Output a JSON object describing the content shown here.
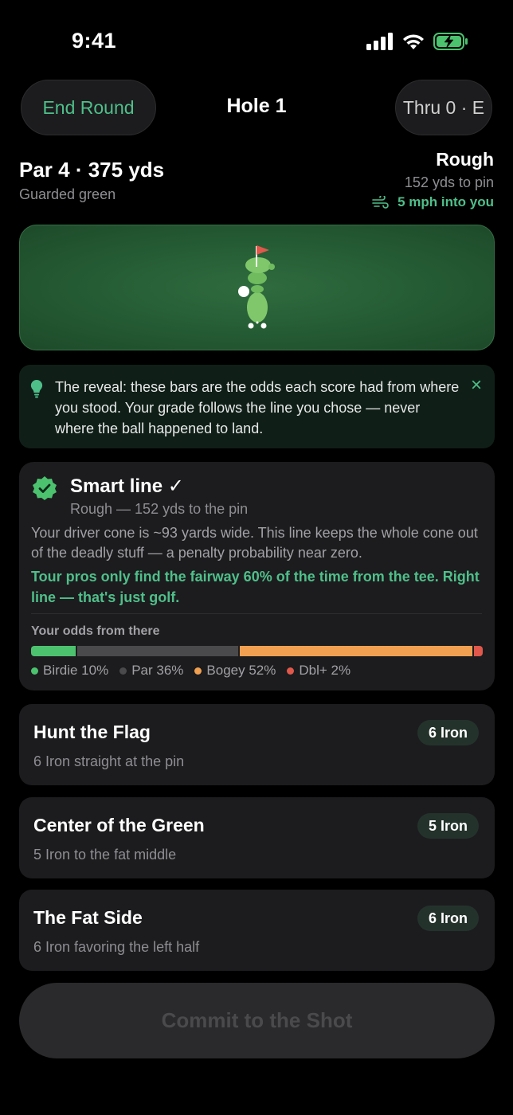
{
  "status": {
    "time": "9:41"
  },
  "header": {
    "end_round_label": "End Round",
    "title": "Hole 1",
    "progress_label": "Thru 0 · E"
  },
  "hole": {
    "par_yards": "Par 4 · 375 yds",
    "feature": "Guarded green",
    "lie": "Rough",
    "to_pin": "152 yds to pin",
    "wind": "5 mph into you"
  },
  "tip": {
    "text": "The reveal: these bars are the odds each score had from where you stood. Your grade follows the line you chose — never where the ball happened to land.",
    "close_icon": "×"
  },
  "smart_card": {
    "title": "Smart line ✓",
    "subtitle": "Rough — 152 yds to the pin",
    "body": "Your driver cone is ~93 yards wide. This line keeps the whole cone out of the deadly stuff — a penalty probability near zero.",
    "tour_note": "Tour pros only find the fairway 60% of the time from the tee. Right line — that's just golf.",
    "odds_title": "Your odds from there",
    "odds": [
      {
        "label": "Birdie 10%",
        "value": 10,
        "color": "#4cc26f"
      },
      {
        "label": "Par 36%",
        "value": 36,
        "color": "#4a4a4d"
      },
      {
        "label": "Bogey 52%",
        "value": 52,
        "color": "#f0a050"
      },
      {
        "label": "Dbl+ 2%",
        "value": 2,
        "color": "#e0584b"
      }
    ]
  },
  "options": [
    {
      "title": "Hunt the Flag",
      "subtitle": "6 Iron straight at the pin",
      "club": "6 Iron"
    },
    {
      "title": "Center of the Green",
      "subtitle": "5 Iron to the fat middle",
      "club": "5 Iron"
    },
    {
      "title": "The Fat Side",
      "subtitle": "6 Iron favoring the left half",
      "club": "6 Iron"
    }
  ],
  "commit_label": "Commit to the Shot",
  "colors": {
    "accent": "#4fbf8a",
    "background": "#000000",
    "card": "#1c1c1e"
  }
}
